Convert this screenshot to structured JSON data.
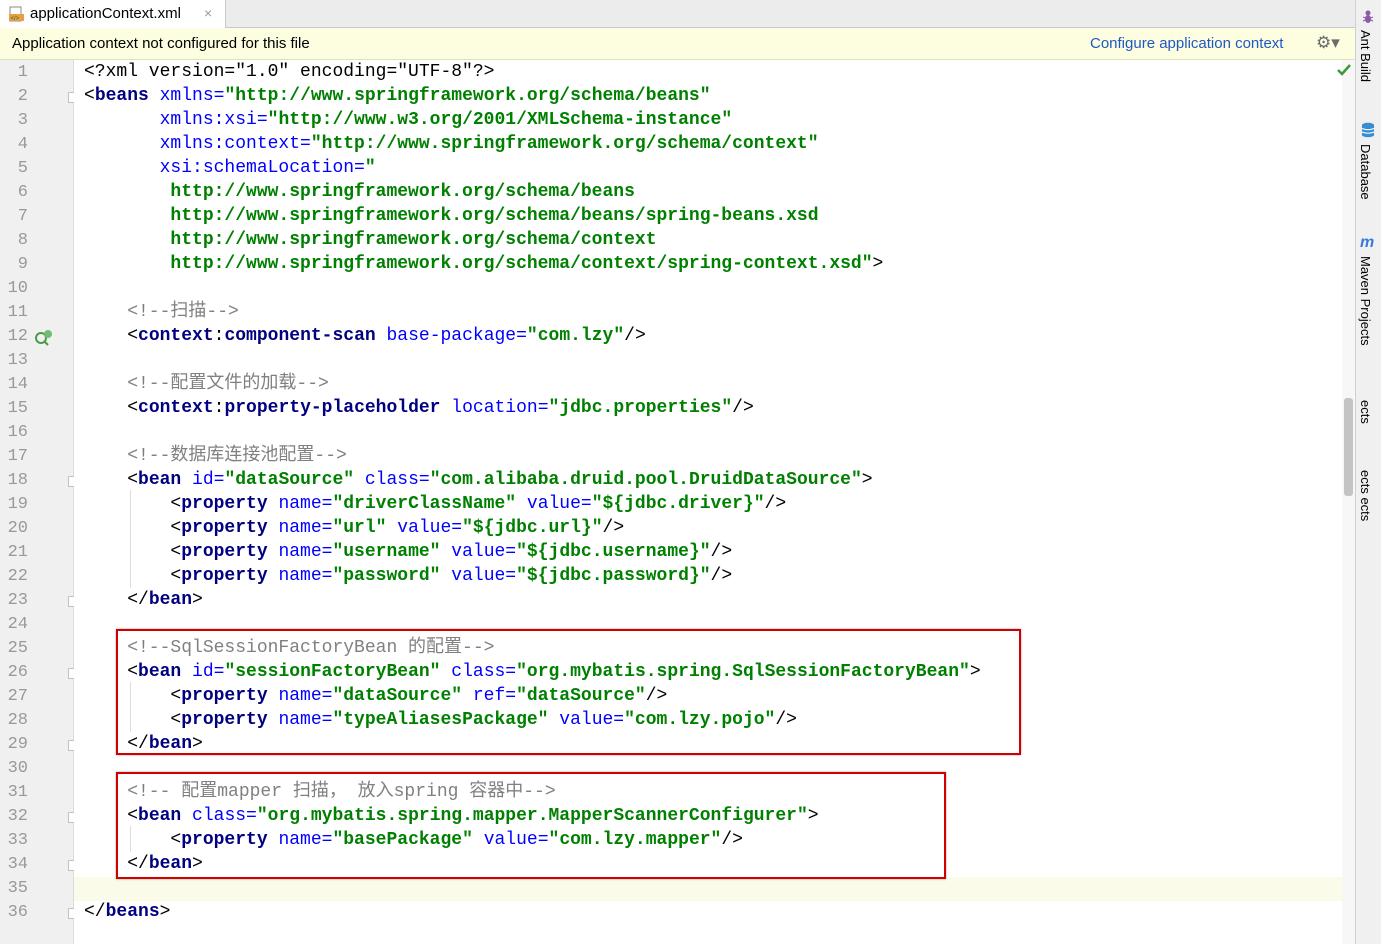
{
  "tab": {
    "filename": "applicationContext.xml",
    "close": "×"
  },
  "banner": {
    "message": "Application context not configured for this file",
    "link": "Configure application context",
    "gear": "⚙▾"
  },
  "sidebar": {
    "tabs": [
      {
        "label": "Ant Build",
        "icon": "ant-icon"
      },
      {
        "label": "Database",
        "icon": "database-icon"
      },
      {
        "label": "Maven Projects",
        "icon": "maven-icon"
      },
      {
        "label": "ects",
        "icon": ""
      },
      {
        "label": "ects ects",
        "icon": ""
      }
    ]
  },
  "colors": {
    "tag": "#000080",
    "attribute": "#0000ff",
    "string": "#008000",
    "comment": "#808080",
    "highlight_box": "#d00000"
  },
  "code": {
    "line_numbers": [
      "1",
      "2",
      "3",
      "4",
      "5",
      "6",
      "7",
      "8",
      "9",
      "10",
      "11",
      "12",
      "13",
      "14",
      "15",
      "16",
      "17",
      "18",
      "19",
      "20",
      "21",
      "22",
      "23",
      "24",
      "25",
      "26",
      "27",
      "28",
      "29",
      "30",
      "31",
      "32",
      "33",
      "34",
      "35",
      "36"
    ],
    "lines": [
      [
        {
          "t": "prolog",
          "v": "<?xml version=\"1.0\" encoding=\"UTF-8\"?>"
        }
      ],
      [
        {
          "t": "bracket",
          "v": "<"
        },
        {
          "t": "tag",
          "v": "beans"
        },
        {
          "t": "attr",
          "v": " xmlns="
        },
        {
          "t": "str",
          "v": "\"http://www.springframework.org/schema/beans\""
        }
      ],
      [
        {
          "t": "attr",
          "v": "       xmlns:xsi="
        },
        {
          "t": "str",
          "v": "\"http://www.w3.org/2001/XMLSchema-instance\""
        }
      ],
      [
        {
          "t": "attr",
          "v": "       xmlns:context="
        },
        {
          "t": "str",
          "v": "\"http://www.springframework.org/schema/context\""
        }
      ],
      [
        {
          "t": "attr",
          "v": "       xsi:schemaLocation="
        },
        {
          "t": "str",
          "v": "\""
        }
      ],
      [
        {
          "t": "str",
          "v": "        http://www.springframework.org/schema/beans"
        }
      ],
      [
        {
          "t": "str",
          "v": "        http://www.springframework.org/schema/beans/spring-beans.xsd"
        }
      ],
      [
        {
          "t": "str",
          "v": "        http://www.springframework.org/schema/context"
        }
      ],
      [
        {
          "t": "str",
          "v": "        http://www.springframework.org/schema/context/spring-context.xsd\""
        },
        {
          "t": "bracket",
          "v": ">"
        }
      ],
      [],
      [
        {
          "t": "comment",
          "v": "    <!--扫描-->"
        }
      ],
      [
        {
          "t": "bracket",
          "v": "    <"
        },
        {
          "t": "ns",
          "v": "context"
        },
        {
          "t": "bracket",
          "v": ":"
        },
        {
          "t": "tag",
          "v": "component-scan"
        },
        {
          "t": "attr",
          "v": " base-package="
        },
        {
          "t": "str",
          "v": "\"com.lzy\""
        },
        {
          "t": "bracket",
          "v": "/>"
        }
      ],
      [],
      [
        {
          "t": "comment",
          "v": "    <!--配置文件的加载-->"
        }
      ],
      [
        {
          "t": "bracket",
          "v": "    <"
        },
        {
          "t": "ns",
          "v": "context"
        },
        {
          "t": "bracket",
          "v": ":"
        },
        {
          "t": "tag",
          "v": "property-placeholder"
        },
        {
          "t": "attr",
          "v": " location="
        },
        {
          "t": "str",
          "v": "\"jdbc.properties\""
        },
        {
          "t": "bracket",
          "v": "/>"
        }
      ],
      [],
      [
        {
          "t": "comment",
          "v": "    <!--数据库连接池配置-->"
        }
      ],
      [
        {
          "t": "bracket",
          "v": "    <"
        },
        {
          "t": "tag",
          "v": "bean"
        },
        {
          "t": "attr",
          "v": " id="
        },
        {
          "t": "str",
          "v": "\"dataSource\""
        },
        {
          "t": "attr",
          "v": " class="
        },
        {
          "t": "str",
          "v": "\"com.alibaba.druid.pool.DruidDataSource\""
        },
        {
          "t": "bracket",
          "v": ">"
        }
      ],
      [
        {
          "t": "bracket",
          "v": "        <"
        },
        {
          "t": "tag",
          "v": "property"
        },
        {
          "t": "attr",
          "v": " name="
        },
        {
          "t": "str",
          "v": "\"driverClassName\""
        },
        {
          "t": "attr",
          "v": " value="
        },
        {
          "t": "str",
          "v": "\"${jdbc.driver}\""
        },
        {
          "t": "bracket",
          "v": "/>"
        }
      ],
      [
        {
          "t": "bracket",
          "v": "        <"
        },
        {
          "t": "tag",
          "v": "property"
        },
        {
          "t": "attr",
          "v": " name="
        },
        {
          "t": "str",
          "v": "\"url\""
        },
        {
          "t": "attr",
          "v": " value="
        },
        {
          "t": "str",
          "v": "\"${jdbc.url}\""
        },
        {
          "t": "bracket",
          "v": "/>"
        }
      ],
      [
        {
          "t": "bracket",
          "v": "        <"
        },
        {
          "t": "tag",
          "v": "property"
        },
        {
          "t": "attr",
          "v": " name="
        },
        {
          "t": "str",
          "v": "\"username\""
        },
        {
          "t": "attr",
          "v": " value="
        },
        {
          "t": "str",
          "v": "\"${jdbc.username}\""
        },
        {
          "t": "bracket",
          "v": "/>"
        }
      ],
      [
        {
          "t": "bracket",
          "v": "        <"
        },
        {
          "t": "tag",
          "v": "property"
        },
        {
          "t": "attr",
          "v": " name="
        },
        {
          "t": "str",
          "v": "\"password\""
        },
        {
          "t": "attr",
          "v": " value="
        },
        {
          "t": "str",
          "v": "\"${jdbc.password}\""
        },
        {
          "t": "bracket",
          "v": "/>"
        }
      ],
      [
        {
          "t": "bracket",
          "v": "    </"
        },
        {
          "t": "tag",
          "v": "bean"
        },
        {
          "t": "bracket",
          "v": ">"
        }
      ],
      [],
      [
        {
          "t": "comment",
          "v": "    <!--SqlSessionFactoryBean 的配置-->"
        }
      ],
      [
        {
          "t": "bracket",
          "v": "    <"
        },
        {
          "t": "tag",
          "v": "bean"
        },
        {
          "t": "attr",
          "v": " id="
        },
        {
          "t": "str",
          "v": "\"sessionFactoryBean\""
        },
        {
          "t": "attr",
          "v": " class="
        },
        {
          "t": "str",
          "v": "\"org.mybatis.spring.SqlSessionFactoryBean\""
        },
        {
          "t": "bracket",
          "v": ">"
        }
      ],
      [
        {
          "t": "bracket",
          "v": "        <"
        },
        {
          "t": "tag",
          "v": "property"
        },
        {
          "t": "attr",
          "v": " name="
        },
        {
          "t": "str",
          "v": "\"dataSource\""
        },
        {
          "t": "attr",
          "v": " ref="
        },
        {
          "t": "str",
          "v": "\"dataSource\""
        },
        {
          "t": "bracket",
          "v": "/>"
        }
      ],
      [
        {
          "t": "bracket",
          "v": "        <"
        },
        {
          "t": "tag",
          "v": "property"
        },
        {
          "t": "attr",
          "v": " name="
        },
        {
          "t": "str",
          "v": "\"typeAliasesPackage\""
        },
        {
          "t": "attr",
          "v": " value="
        },
        {
          "t": "str",
          "v": "\"com.lzy.pojo\""
        },
        {
          "t": "bracket",
          "v": "/>"
        }
      ],
      [
        {
          "t": "bracket",
          "v": "    </"
        },
        {
          "t": "tag",
          "v": "bean"
        },
        {
          "t": "bracket",
          "v": ">"
        }
      ],
      [],
      [
        {
          "t": "comment",
          "v": "    <!-- 配置mapper 扫描， 放入spring 容器中-->"
        }
      ],
      [
        {
          "t": "bracket",
          "v": "    <"
        },
        {
          "t": "tag",
          "v": "bean"
        },
        {
          "t": "attr",
          "v": " class="
        },
        {
          "t": "str",
          "v": "\"org.mybatis.spring.mapper.MapperScannerConfigurer\""
        },
        {
          "t": "bracket",
          "v": ">"
        }
      ],
      [
        {
          "t": "bracket",
          "v": "        <"
        },
        {
          "t": "tag",
          "v": "property"
        },
        {
          "t": "attr",
          "v": " name="
        },
        {
          "t": "str",
          "v": "\"basePackage\""
        },
        {
          "t": "attr",
          "v": " value="
        },
        {
          "t": "str",
          "v": "\"com.lzy.mapper\""
        },
        {
          "t": "bracket",
          "v": "/>"
        }
      ],
      [
        {
          "t": "bracket",
          "v": "    </"
        },
        {
          "t": "tag",
          "v": "bean"
        },
        {
          "t": "bracket",
          "v": ">"
        }
      ],
      [],
      [
        {
          "t": "bracket",
          "v": "</"
        },
        {
          "t": "tag",
          "v": "beans"
        },
        {
          "t": "bracket",
          "v": ">"
        }
      ]
    ]
  }
}
